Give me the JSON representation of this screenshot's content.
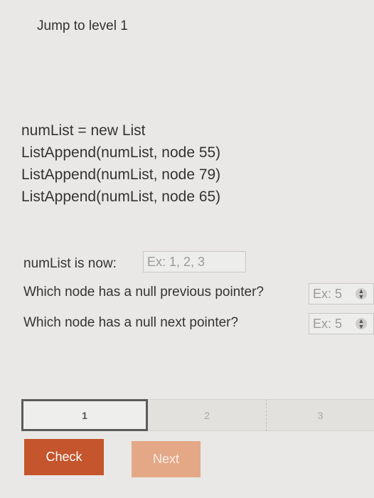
{
  "header": {
    "jump_link": "Jump to level 1"
  },
  "code": {
    "lines": [
      "numList = new List",
      "ListAppend(numList, node 55)",
      "ListAppend(numList, node 79)",
      "ListAppend(numList, node 65)"
    ]
  },
  "questions": {
    "q1": {
      "label": "numList is now:",
      "placeholder": "Ex: 1, 2, 3"
    },
    "q2": {
      "label": "Which node has a null previous pointer?",
      "placeholder": "Ex: 5"
    },
    "q3": {
      "label": "Which node has a null next pointer?",
      "placeholder": "Ex: 5"
    }
  },
  "levels": {
    "items": [
      "1",
      "2",
      "3"
    ],
    "current": "1"
  },
  "buttons": {
    "check": "Check",
    "next": "Next"
  },
  "colors": {
    "check_button": "#c4552c",
    "next_button": "#e4a887",
    "background": "#e9e8e6"
  }
}
